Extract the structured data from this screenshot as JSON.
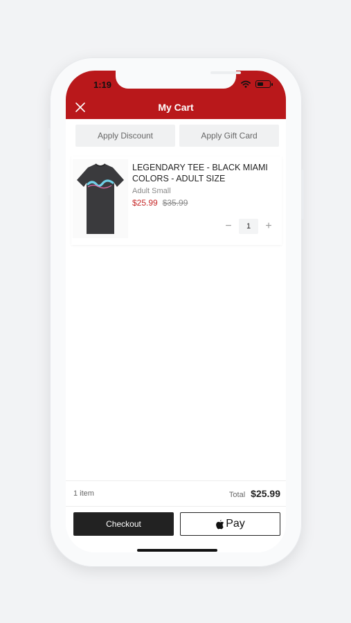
{
  "status_bar": {
    "time": "1:19"
  },
  "header": {
    "title": "My Cart",
    "close_icon": "close-icon"
  },
  "actions": {
    "apply_discount": "Apply Discount",
    "apply_gift_card": "Apply Gift Card"
  },
  "cart": {
    "items": [
      {
        "name": "LEGENDARY TEE - BLACK MIAMI COLORS - ADULT SIZE",
        "variant": "Adult Small",
        "sale_price": "$25.99",
        "original_price": "$35.99",
        "quantity": "1"
      }
    ]
  },
  "footer": {
    "item_count": "1 item",
    "total_label": "Total",
    "total_value": "$25.99",
    "checkout_label": "Checkout",
    "applepay_label": "Pay"
  },
  "colors": {
    "brand_red": "#b9181b",
    "sale_red": "#c62828",
    "dark": "#222222"
  }
}
